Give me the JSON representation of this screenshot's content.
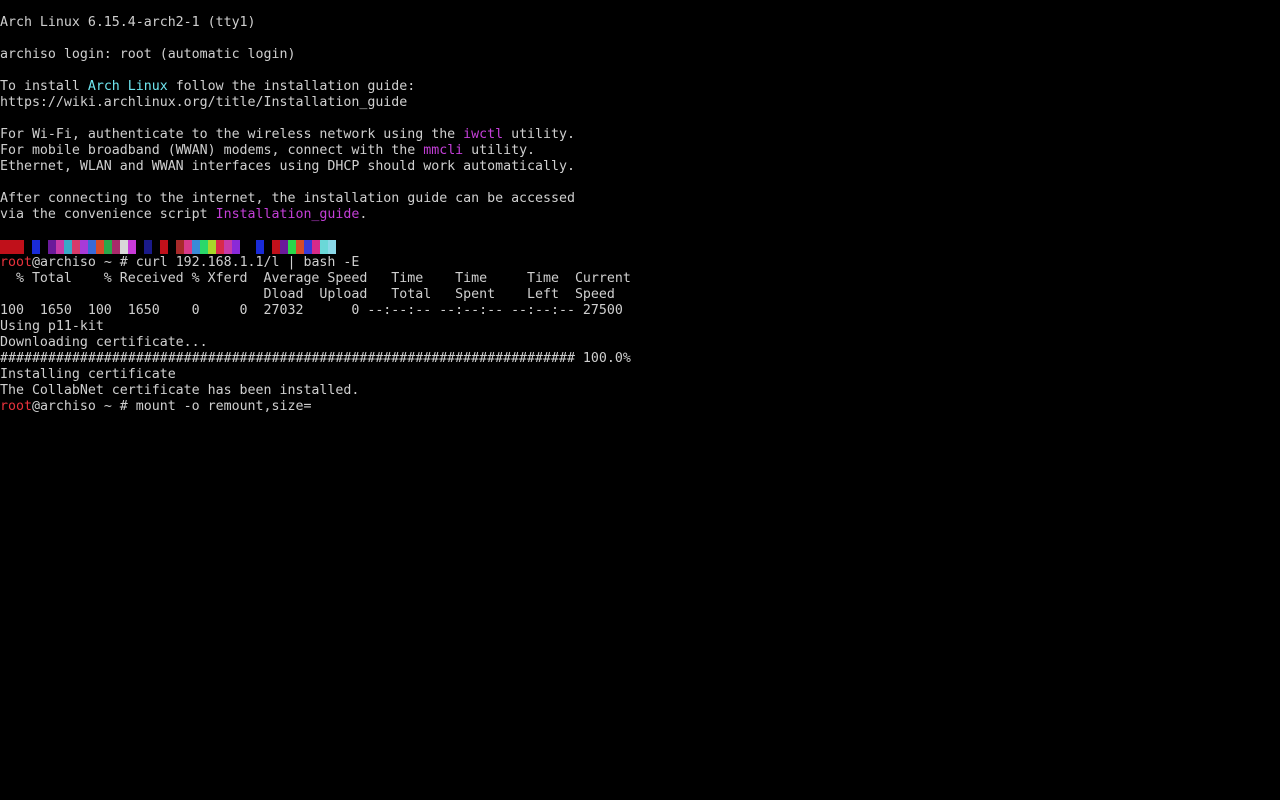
{
  "terminal": {
    "colors": {
      "foreground": "#cfcfcf",
      "background": "#000000",
      "cyan": "#6fe6f0",
      "magenta": "#c43fd8",
      "red": "#e8323c"
    },
    "banner": "Arch Linux 6.15.4-arch2-1 (tty1)",
    "login": "archiso login: root (automatic login)",
    "install_prefix": "To install ",
    "install_highlight": "Arch Linux",
    "install_suffix": " follow the installation guide:",
    "install_url": "https://wiki.archlinux.org/title/Installation_guide",
    "wifi_prefix": "For Wi-Fi, authenticate to the wireless network using the ",
    "wifi_tool": "iwctl",
    "wifi_suffix": " utility.",
    "wwan_prefix": "For mobile broadband (WWAN) modems, connect with the ",
    "wwan_tool": "mmcli",
    "wwan_suffix": " utility.",
    "ethernet": "Ethernet, WLAN and WWAN interfaces using DHCP should work automatically.",
    "after_line1": "After connecting to the internet, the installation guide can be accessed",
    "after_prefix": "via the convenience script ",
    "after_script": "Installation_guide",
    "after_suffix": ".",
    "prompt_user": "root",
    "prompt_host": "@archiso ~ # ",
    "command1": "curl 192.168.1.1/l | bash -E",
    "curl_header1": "  % Total    % Received % Xferd  Average Speed   Time    Time     Time  Current",
    "curl_header2": "                                 Dload  Upload   Total   Spent    Left  Speed",
    "curl_row": "100  1650  100  1650    0     0  27032      0 --:--:-- --:--:-- --:--:-- 27500",
    "p11": "Using p11-kit",
    "downloading": "Downloading certificate...",
    "progress": "######################################################################## 100.0%",
    "installing": "Installing certificate",
    "installed": "The CollabNet certificate has been installed.",
    "command2": "mount -o remount,size="
  }
}
